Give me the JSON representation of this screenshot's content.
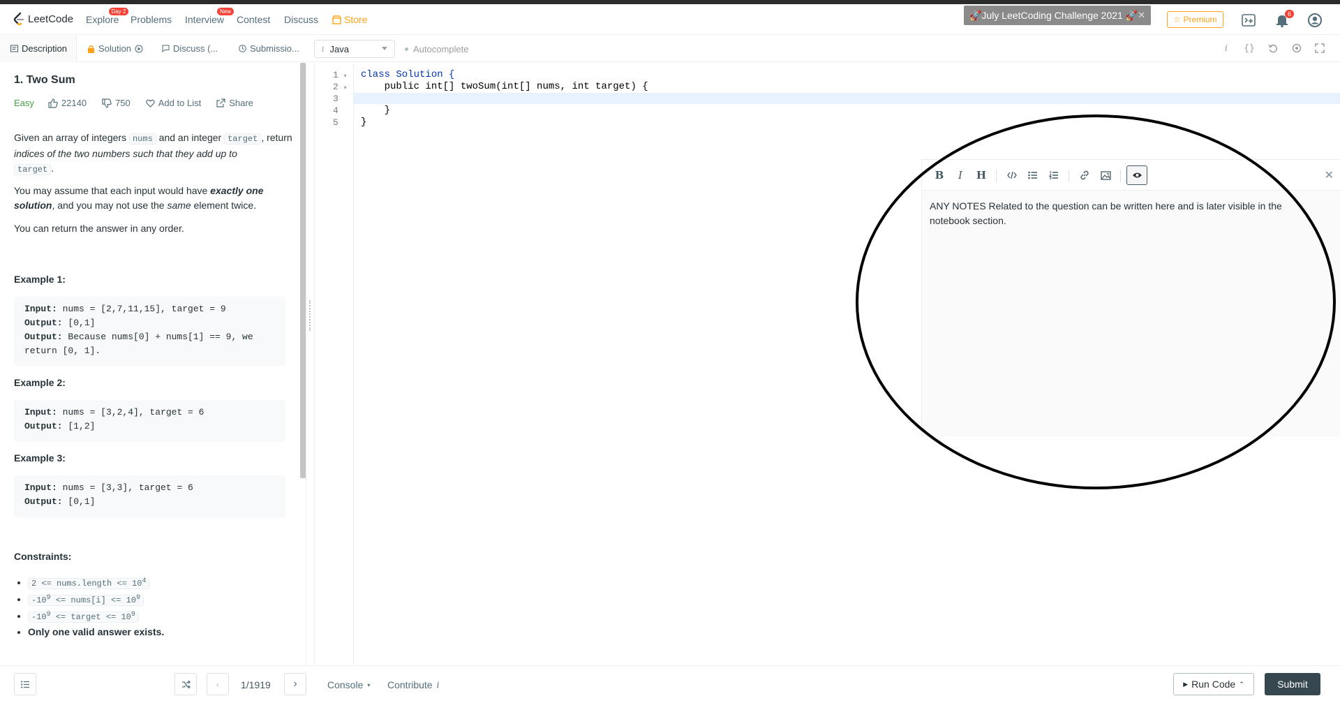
{
  "nav": {
    "logo_text": "LeetCode",
    "links": [
      "Explore",
      "Problems",
      "Interview",
      "Contest",
      "Discuss",
      "Store"
    ],
    "explore_badge": "Day 2",
    "interview_badge": "New",
    "challenge": "🚀July LeetCoding Challenge 2021 🚀",
    "premium": "☆ Premium",
    "notif_count": "6"
  },
  "tabs": {
    "description": "Description",
    "solution": "Solution",
    "discuss": "Discuss (...",
    "submissions": "Submissio..."
  },
  "editor_bar": {
    "language": "Java",
    "autocomplete": "Autocomplete"
  },
  "problem": {
    "title": "1. Two Sum",
    "difficulty": "Easy",
    "likes": "22140",
    "dislikes": "750",
    "add_to_list": "Add to List",
    "share": "Share",
    "para1_a": "Given an array of integers ",
    "para1_code1": "nums",
    "para1_b": " and an integer ",
    "para1_code2": "target",
    "para1_c": ", return ",
    "para1_em": "indices of the two numbers such that they add up to",
    "para1_code3": "target",
    "para1_d": ".",
    "para2_a": "You may assume that each input would have ",
    "para2_strong": "exactly one solution",
    "para2_b": ", and you may not use the ",
    "para2_em": "same",
    "para2_c": " element twice.",
    "para3": "You can return the answer in any order.",
    "examples": [
      {
        "title": "Example 1:",
        "input_label": "Input:",
        "input": " nums = [2,7,11,15], target = 9",
        "output_label": "Output:",
        "output": " [0,1]",
        "explain_label": "Output:",
        "explain": " Because nums[0] + nums[1] == 9, we return [0, 1]."
      },
      {
        "title": "Example 2:",
        "input_label": "Input:",
        "input": " nums = [3,2,4], target = 6",
        "output_label": "Output:",
        "output": " [1,2]"
      },
      {
        "title": "Example 3:",
        "input_label": "Input:",
        "input": " nums = [3,3], target = 6",
        "output_label": "Output:",
        "output": " [0,1]"
      }
    ],
    "constraints_title": "Constraints:",
    "constraints": [
      {
        "base": "2 <= nums.length <= 10",
        "sup": "4",
        "pre": ""
      },
      {
        "pre": "-10",
        "pre_sup": "9",
        "base": " <= nums[i] <= 10",
        "sup": "9"
      },
      {
        "pre": "-10",
        "pre_sup": "9",
        "base": " <= target <= 10",
        "sup": "9"
      }
    ],
    "constraint_last": "Only one valid answer exists."
  },
  "code_lines": [
    "class Solution {",
    "    public int[] twoSum(int[] nums, int target) {",
    "        ",
    "    }",
    "}"
  ],
  "line_numbers": [
    "1",
    "2",
    "3",
    "4",
    "5"
  ],
  "notes": {
    "text": "ANY NOTES Related to the question can be written here and is later visible in the notebook section."
  },
  "bottom": {
    "pager": "1/1919",
    "console": "Console",
    "contribute": "Contribute",
    "run_code": "Run Code",
    "submit": "Submit"
  }
}
